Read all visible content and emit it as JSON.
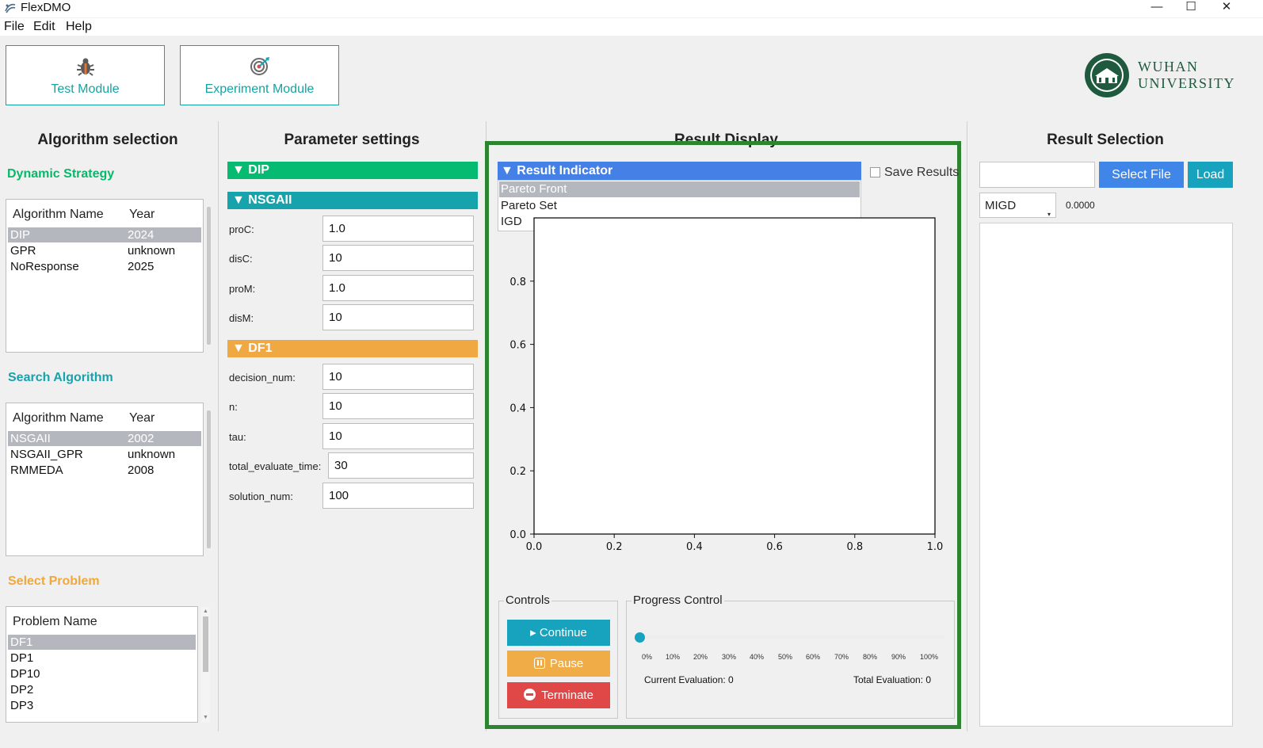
{
  "window": {
    "title": "FlexDMO",
    "controls": {
      "minimize": "—",
      "maximize": "☐",
      "close": "✕"
    }
  },
  "menu": [
    "File",
    "Edit",
    "Help"
  ],
  "modules": [
    {
      "label": "Test Module",
      "icon": "bug-icon"
    },
    {
      "label": "Experiment Module",
      "icon": "target-icon"
    }
  ],
  "logo": {
    "line1": "WUHAN",
    "line2": "UNIVERSITY",
    "seal": "wuhan-university-seal"
  },
  "algorithm_selection": {
    "title": "Algorithm selection",
    "dynamic_strategy": {
      "label": "Dynamic Strategy",
      "header_name": "Algorithm Name",
      "header_year": "Year",
      "rows": [
        {
          "name": "DIP",
          "year": "2024"
        },
        {
          "name": "GPR",
          "year": "unknown"
        },
        {
          "name": "NoResponse",
          "year": "2025"
        }
      ]
    },
    "search_algorithm": {
      "label": "Search Algorithm",
      "header_name": "Algorithm Name",
      "header_year": "Year",
      "rows": [
        {
          "name": "NSGAII",
          "year": "2002"
        },
        {
          "name": "NSGAII_GPR",
          "year": "unknown"
        },
        {
          "name": "RMMEDA",
          "year": "2008"
        }
      ]
    },
    "select_problem": {
      "label": "Select Problem",
      "header_name": "Problem Name",
      "rows": [
        "DF1",
        "DP1",
        "DP10",
        "DP2",
        "DP3"
      ]
    },
    "colors": {
      "dynamic": "#08b86a",
      "search": "#17a3ab",
      "problem": "#f0a83a"
    }
  },
  "parameter_settings": {
    "title": "Parameter settings",
    "sections": {
      "dip": {
        "title": "▼ DIP",
        "color": "#05ba71"
      },
      "nsgaii": {
        "title": "▼ NSGAII",
        "color": "#17a3ab",
        "params": [
          {
            "label": "proC:",
            "value": "1.0"
          },
          {
            "label": "disC:",
            "value": "10"
          },
          {
            "label": "proM:",
            "value": "1.0"
          },
          {
            "label": "disM:",
            "value": "10"
          }
        ]
      },
      "df1": {
        "title": "▼ DF1",
        "color": "#f0a843",
        "params": [
          {
            "label": "decision_num:",
            "value": "10"
          },
          {
            "label": "n:",
            "value": "10"
          },
          {
            "label": "tau:",
            "value": "10"
          },
          {
            "label": "total_evaluate_time:",
            "value": "30"
          },
          {
            "label": "solution_num:",
            "value": "100"
          }
        ]
      }
    }
  },
  "result_display": {
    "title": "Result Display",
    "indicator_header": "▼ Result Indicator",
    "indicator_options": [
      "Pareto Front",
      "Pareto Set",
      "IGD"
    ],
    "selected_indicator": "Pareto Front",
    "save_results_label": "Save Results",
    "save_results_checked": false,
    "controls": {
      "legend": "Controls",
      "continue": "▸ Continue",
      "pause": "Pause",
      "terminate": "Terminate"
    },
    "progress": {
      "legend": "Progress Control",
      "ticks": [
        "0%",
        "10%",
        "20%",
        "30%",
        "40%",
        "50%",
        "60%",
        "70%",
        "80%",
        "90%",
        "100%"
      ],
      "value_fraction": 0,
      "current_evaluation": "Current Evaluation: 0",
      "total_evaluation": "Total Evaluation: 0"
    },
    "colors": {
      "frame": "#2e8531",
      "continue": "#17a3be",
      "pause": "#f0ac46",
      "terminate": "#e04848"
    }
  },
  "chart_data": {
    "type": "scatter",
    "title": "",
    "xlabel": "",
    "ylabel": "",
    "xlim": [
      0.0,
      1.0
    ],
    "ylim": [
      0.0,
      1.0
    ],
    "xticks": [
      "0.0",
      "0.2",
      "0.4",
      "0.6",
      "0.8",
      "1.0"
    ],
    "yticks": [
      "0.0",
      "0.2",
      "0.4",
      "0.6",
      "0.8"
    ],
    "series": []
  },
  "result_selection": {
    "title": "Result Selection",
    "file_input": "",
    "select_file": "Select File",
    "load": "Load",
    "metric": "MIGD",
    "metric_value": "0.0000",
    "colors": {
      "select_file": "#3f86e8",
      "load": "#17a3be"
    }
  }
}
